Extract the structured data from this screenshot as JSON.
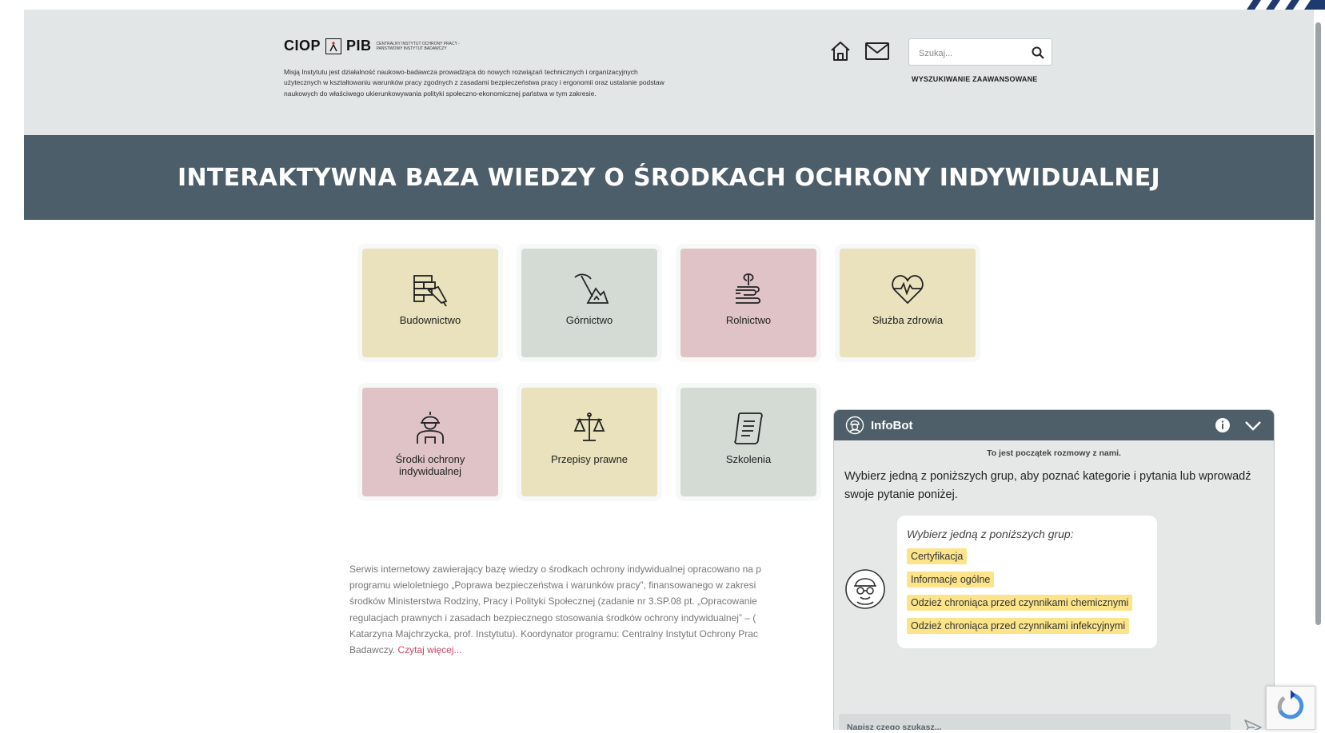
{
  "header": {
    "logo_left": "CIOP",
    "logo_right": "PIB",
    "logo_subtitle": "Centralny Instytut Ochrony Pracy - Państwowy Instytut Badawczy",
    "mission_text": "Misją Instytutu jest działalność naukowo-badawcza prowadząca do nowych rozwiązań technicznych i organizacyjnych użytecznych w kształtowaniu warunków pracy zgodnych z zasadami bezpieczeństwa pracy i ergonomii oraz ustalanie podstaw naukowych do właściwego ukierunkowywania polityki społeczno-ekonomicznej państwa w tym zakresie.",
    "icons": [
      "home-icon",
      "mail-icon"
    ],
    "search": {
      "placeholder": "Szukaj...",
      "value": ""
    },
    "advanced_search_label": "WYSZUKIWANIE ZAAWANSOWANE"
  },
  "banner": {
    "title": "INTERAKTYWNA BAZA WIEDZY O ŚRODKACH OCHRONY INDYWIDUALNEJ",
    "color": "#4c5e6a"
  },
  "tiles": [
    {
      "label": "Budownictwo",
      "icon": "bricks-trowel-icon",
      "color": "#e9e2bc"
    },
    {
      "label": "Górnictwo",
      "icon": "pickaxe-mountain-icon",
      "color": "#d4dbd5"
    },
    {
      "label": "Rolnictwo",
      "icon": "hand-plant-icon",
      "color": "#dfc3c6"
    },
    {
      "label": "Służba zdrowia",
      "icon": "heart-pulse-icon",
      "color": "#e9e2bc"
    },
    {
      "label": "Środki ochrony indywidualnej",
      "icon": "worker-helmet-icon",
      "color": "#dfc3c6"
    },
    {
      "label": "Przepisy prawne",
      "icon": "scales-icon",
      "color": "#e9e2bc"
    },
    {
      "label": "Szkolenia",
      "icon": "scroll-icon",
      "color": "#d4dbd5"
    }
  ],
  "description": {
    "lines": [
      "Serwis internetowy zawierający bazę wiedzy o środkach ochrony indywidualnej opracowano na p",
      "programu wieloletniego „Poprawa bezpieczeństwa i warunków pracy”, finansowanego w zakresi",
      "środków Ministerstwa Rodziny, Pracy i Polityki Społecznej (zadanie nr 3.SP.08 pt. „Opracowanie",
      "regulacjach prawnych i zasadach bezpiecznego stosowania środków ochrony indywidualnej” – (",
      "Katarzyna Majchrzycka, prof. Instytutu). Koordynator programu: Centralny Instytut Ochrony Prac",
      "Badawczy."
    ],
    "read_more": "Czytaj więcej..."
  },
  "chat": {
    "title": "InfoBot",
    "start_note": "To jest początek rozmowy z nami.",
    "intro": "Wybierz jedną z poniższych grup, aby poznać kategorie i pytania lub wprowadź swoje pytanie poniżej.",
    "bubble_prompt": "Wybierz jedną z poniższych grup:",
    "options": [
      "Certyfikacja",
      "Informacje ogólne",
      "Odzież chroniąca przed czynnikami chemicznymi",
      "Odzież chroniąca przed czynnikami infekcyjnymi"
    ],
    "input_placeholder": "Napisz czego szukasz...",
    "header_color": "#4f5f69",
    "chip_color": "#fbe48a"
  }
}
